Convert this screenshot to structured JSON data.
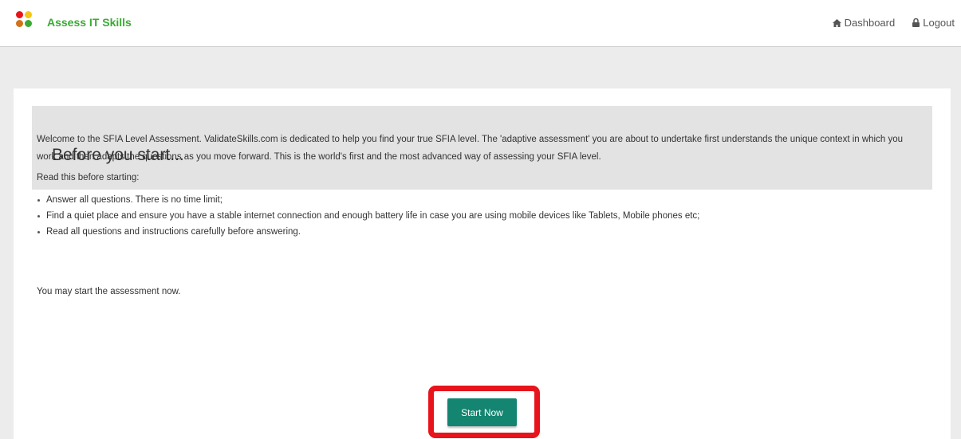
{
  "header": {
    "brand": "Assess IT Skills",
    "logo_dot_colors": [
      "#e8141b",
      "#f5c518",
      "#d2731a",
      "#3aab34"
    ],
    "nav": [
      {
        "label": "Dashboard",
        "icon": "home-icon"
      },
      {
        "label": "Logout",
        "icon": "lock-icon"
      }
    ]
  },
  "main": {
    "title": "Before you start...",
    "intro": "Welcome to the SFIA Level Assessment. ValidateSkills.com is dedicated to help you find your true SFIA level. The 'adaptive assessment' you are about to undertake first understands the unique context in which you work and then adapts the questions as you move forward. This is the world's first and the most advanced way of assessing your SFIA level.",
    "read_label": "Read this before starting:",
    "bullets": [
      "Answer all questions. There is no time limit;",
      "Find a quiet place and ensure you have a stable internet connection and enough battery life in case you are using mobile devices like Tablets, Mobile phones etc;",
      "Read all questions and instructions carefully before answering."
    ],
    "closing": "You may start the assessment now.",
    "start_button": "Start Now"
  },
  "colors": {
    "brand_green": "#3aab34",
    "button_teal": "#138570",
    "highlight_red": "#e8141b",
    "banner_gray": "#e2e3e2"
  }
}
